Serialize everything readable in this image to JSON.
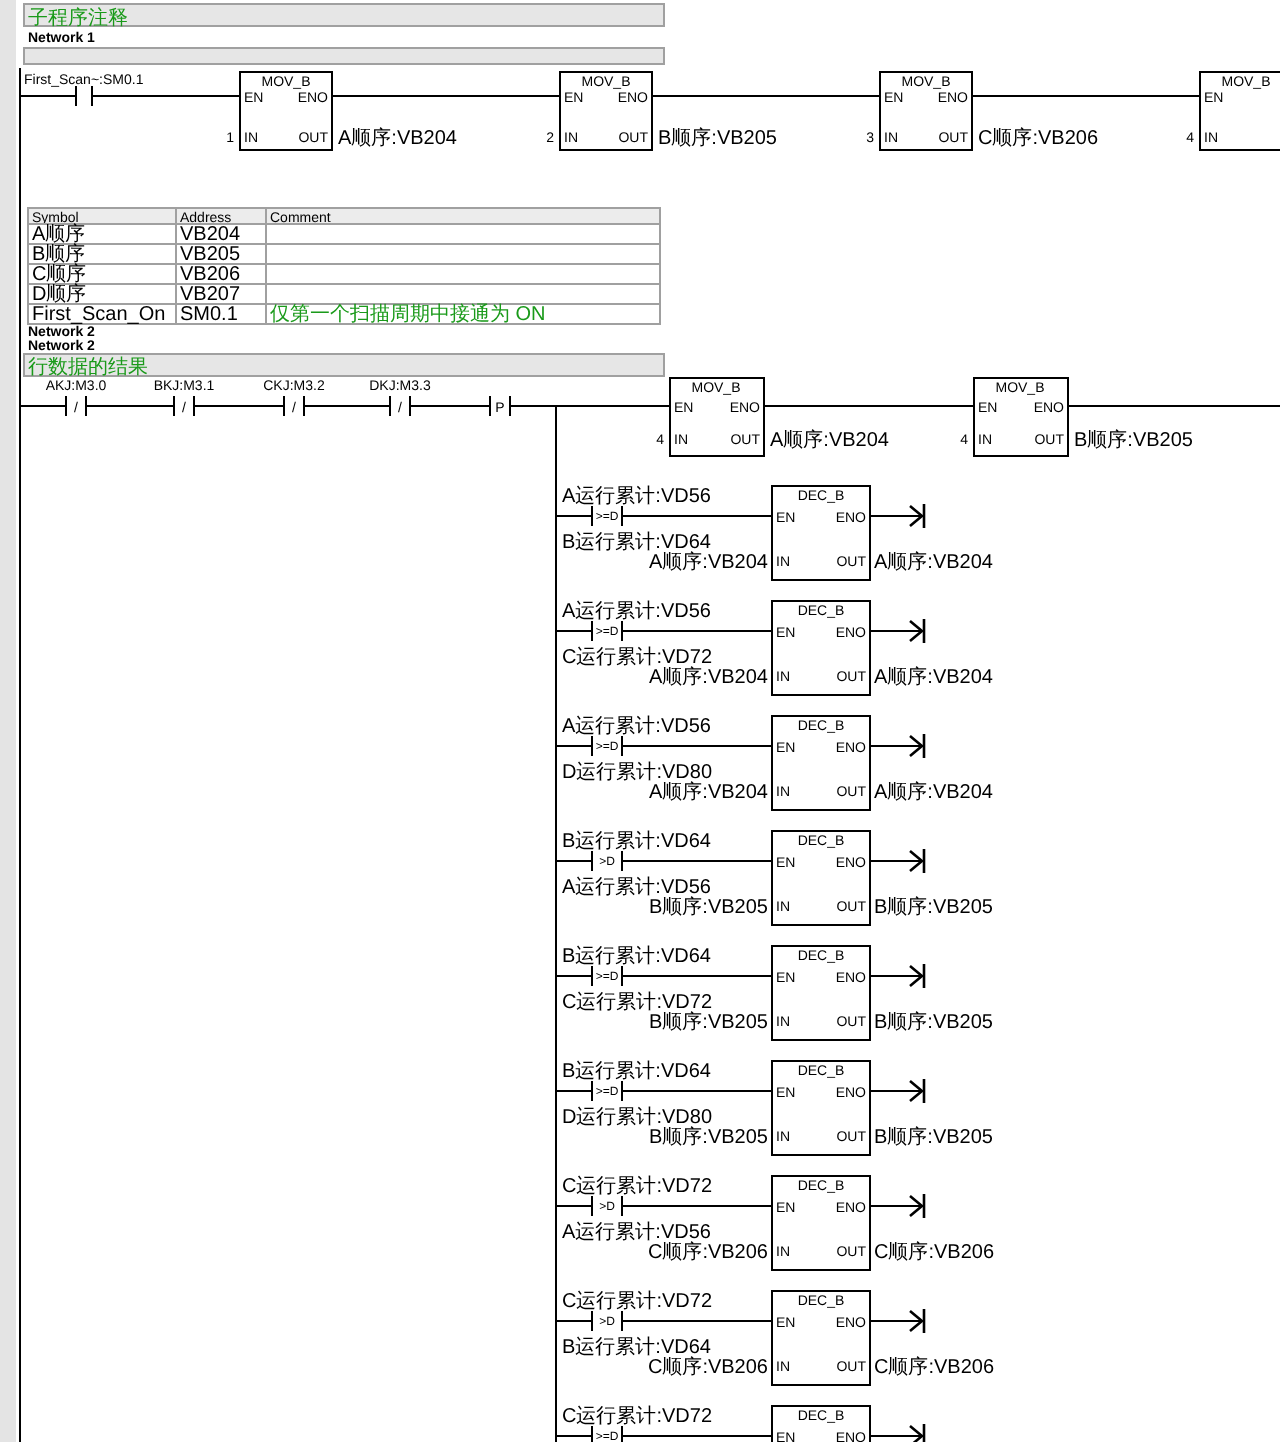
{
  "subroutine_comment": "子程序注释",
  "network1": {
    "title": "Network 1",
    "contact": "First_Scan~:SM0.1",
    "blocks": [
      {
        "name": "MOV_B",
        "en": "EN",
        "eno": "ENO",
        "in_pin": "IN",
        "out_pin": "OUT",
        "in": "1",
        "out": "A顺序:VB204"
      },
      {
        "name": "MOV_B",
        "en": "EN",
        "eno": "ENO",
        "in_pin": "IN",
        "out_pin": "OUT",
        "in": "2",
        "out": "B顺序:VB205"
      },
      {
        "name": "MOV_B",
        "en": "EN",
        "eno": "ENO",
        "in_pin": "IN",
        "out_pin": "OUT",
        "in": "3",
        "out": "C顺序:VB206"
      },
      {
        "name": "MOV_B",
        "en": "EN",
        "in_pin": "IN",
        "in": "4"
      }
    ]
  },
  "symbol_table": {
    "columns": [
      "Symbol",
      "Address",
      "Comment"
    ],
    "rows": [
      [
        "A顺序",
        "VB204",
        ""
      ],
      [
        "B顺序",
        "VB205",
        ""
      ],
      [
        "C顺序",
        "VB206",
        ""
      ],
      [
        "D顺序",
        "VB207",
        ""
      ],
      [
        "First_Scan_On",
        "SM0.1",
        "仅第一个扫描周期中接通为 ON"
      ]
    ]
  },
  "network2": {
    "title": "Network 2",
    "title_repeat": "Network 2",
    "comment": "行数据的结果",
    "contacts": [
      {
        "label": "AKJ:M3.0",
        "sign": "/"
      },
      {
        "label": "BKJ:M3.1",
        "sign": "/"
      },
      {
        "label": "CKJ:M3.2",
        "sign": "/"
      },
      {
        "label": "DKJ:M3.3",
        "sign": "/"
      },
      {
        "sign": "P"
      }
    ],
    "blocks": [
      {
        "name": "MOV_B",
        "en": "EN",
        "eno": "ENO",
        "in_pin": "IN",
        "out_pin": "OUT",
        "in": "4",
        "out": "A顺序:VB204"
      },
      {
        "name": "MOV_B",
        "en": "EN",
        "eno": "ENO",
        "in_pin": "IN",
        "out_pin": "OUT",
        "in": "4",
        "out": "B顺序:VB205"
      }
    ],
    "rungs": [
      {
        "top": "A运行累计:VD56",
        "op": ">=D",
        "bottom": "B运行累计:VD64",
        "block": {
          "name": "DEC_B",
          "en": "EN",
          "eno": "ENO",
          "in_pin": "IN",
          "out_pin": "OUT",
          "in": "A顺序:VB204",
          "out": "A顺序:VB204"
        }
      },
      {
        "top": "A运行累计:VD56",
        "op": ">=D",
        "bottom": "C运行累计:VD72",
        "block": {
          "name": "DEC_B",
          "en": "EN",
          "eno": "ENO",
          "in_pin": "IN",
          "out_pin": "OUT",
          "in": "A顺序:VB204",
          "out": "A顺序:VB204"
        }
      },
      {
        "top": "A运行累计:VD56",
        "op": ">=D",
        "bottom": "D运行累计:VD80",
        "block": {
          "name": "DEC_B",
          "en": "EN",
          "eno": "ENO",
          "in_pin": "IN",
          "out_pin": "OUT",
          "in": "A顺序:VB204",
          "out": "A顺序:VB204"
        }
      },
      {
        "top": "B运行累计:VD64",
        "op": ">D",
        "bottom": "A运行累计:VD56",
        "block": {
          "name": "DEC_B",
          "en": "EN",
          "eno": "ENO",
          "in_pin": "IN",
          "out_pin": "OUT",
          "in": "B顺序:VB205",
          "out": "B顺序:VB205"
        }
      },
      {
        "top": "B运行累计:VD64",
        "op": ">=D",
        "bottom": "C运行累计:VD72",
        "block": {
          "name": "DEC_B",
          "en": "EN",
          "eno": "ENO",
          "in_pin": "IN",
          "out_pin": "OUT",
          "in": "B顺序:VB205",
          "out": "B顺序:VB205"
        }
      },
      {
        "top": "B运行累计:VD64",
        "op": ">=D",
        "bottom": "D运行累计:VD80",
        "block": {
          "name": "DEC_B",
          "en": "EN",
          "eno": "ENO",
          "in_pin": "IN",
          "out_pin": "OUT",
          "in": "B顺序:VB205",
          "out": "B顺序:VB205"
        }
      },
      {
        "top": "C运行累计:VD72",
        "op": ">D",
        "bottom": "A运行累计:VD56",
        "block": {
          "name": "DEC_B",
          "en": "EN",
          "eno": "ENO",
          "in_pin": "IN",
          "out_pin": "OUT",
          "in": "C顺序:VB206",
          "out": "C顺序:VB206"
        }
      },
      {
        "top": "C运行累计:VD72",
        "op": ">D",
        "bottom": "B运行累计:VD64",
        "block": {
          "name": "DEC_B",
          "en": "EN",
          "eno": "ENO",
          "in_pin": "IN",
          "out_pin": "OUT",
          "in": "C顺序:VB206",
          "out": "C顺序:VB206"
        }
      },
      {
        "top": "C运行累计:VD72",
        "op": ">=D",
        "block": {
          "name": "DEC_B",
          "en": "EN",
          "eno": "ENO"
        }
      }
    ]
  }
}
